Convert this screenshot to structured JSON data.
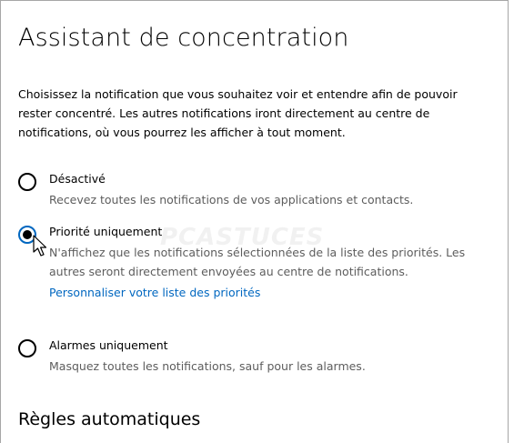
{
  "page": {
    "title": "Assistant de concentration",
    "intro": "Choisissez la notification que vous souhaitez voir et entendre afin de pouvoir rester concentré. Les autres notifications iront directement au centre de notifications, où vous pourrez les afficher à tout moment."
  },
  "options": [
    {
      "label": "Désactivé",
      "description": "Recevez toutes les notifications de vos applications et contacts.",
      "selected": false
    },
    {
      "label": "Priorité uniquement",
      "description": "N'affichez que les notifications sélectionnées de la liste des priorités. Les autres seront directement envoyées au centre de notifications.",
      "link": "Personnaliser votre liste des priorités",
      "selected": true
    },
    {
      "label": "Alarmes uniquement",
      "description": "Masquez toutes les notifications, sauf pour les alarmes.",
      "selected": false
    }
  ],
  "sections": {
    "automatic_rules": "Règles automatiques"
  },
  "watermark": "PCASTUCES",
  "colors": {
    "accent": "#0067c0",
    "secondary_text": "#5d5d5d",
    "text": "#000000",
    "background": "#ffffff"
  },
  "icons": {
    "cursor": "pointer-arrow-icon"
  }
}
